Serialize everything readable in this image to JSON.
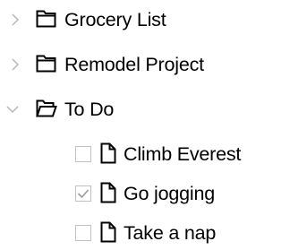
{
  "tree": {
    "folders": [
      {
        "label": "Grocery List",
        "expanded": false,
        "icon": "folder-closed-icon"
      },
      {
        "label": "Remodel Project",
        "expanded": false,
        "icon": "folder-closed-icon"
      },
      {
        "label": "To Do",
        "expanded": true,
        "icon": "folder-open-icon",
        "children": [
          {
            "label": "Climb Everest",
            "checked": false,
            "icon": "file-icon"
          },
          {
            "label": "Go jogging",
            "checked": true,
            "icon": "file-icon"
          },
          {
            "label": "Take a nap",
            "checked": false,
            "icon": "file-icon"
          }
        ]
      }
    ]
  },
  "colors": {
    "chevron": "#b7b7b7",
    "checkbox_border": "#c2c2c2",
    "checkmark": "#9a9a9a",
    "icon_stroke": "#000000",
    "text": "#000000"
  }
}
